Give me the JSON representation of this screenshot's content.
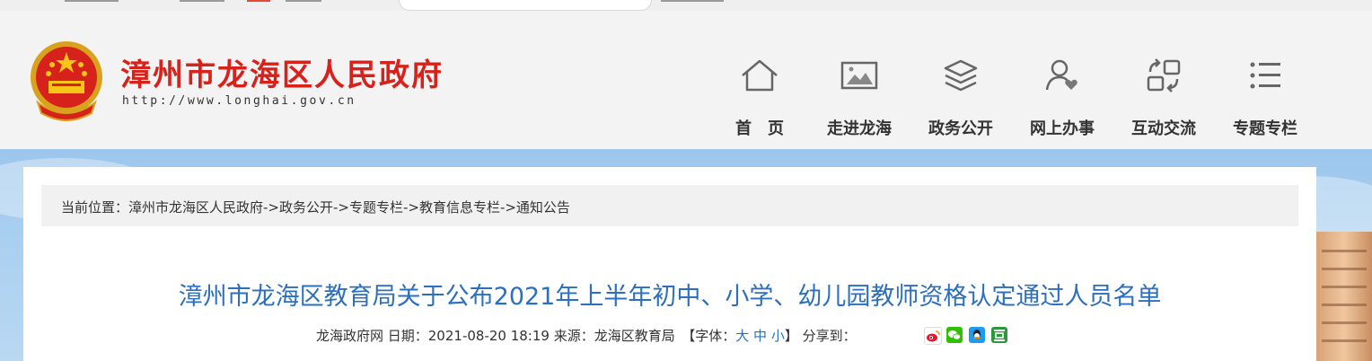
{
  "header": {
    "site_title": "漳州市龙海区人民政府",
    "site_url": "http://www.longhai.gov.cn"
  },
  "nav": [
    {
      "label": "首　页",
      "icon": "home-icon"
    },
    {
      "label": "走进龙海",
      "icon": "gallery-icon"
    },
    {
      "label": "政务公开",
      "icon": "layers-icon"
    },
    {
      "label": "网上办事",
      "icon": "user-heart-icon"
    },
    {
      "label": "互动交流",
      "icon": "exchange-icon"
    },
    {
      "label": "专题专栏",
      "icon": "list-icon"
    }
  ],
  "breadcrumb": "当前位置：漳州市龙海区人民政府->政务公开->专题专栏->教育信息专栏->通知公告",
  "article": {
    "title": "漳州市龙海区教育局关于公布2021年上半年初中、小学、幼儿园教师资格认定通过人员名单",
    "meta_prefix": "龙海政府网 日期：2021-08-20 18:19  来源：龙海区教育局　【字体：",
    "font_large": "大",
    "font_medium": "中",
    "font_small": "小",
    "meta_suffix": "】 分享到：",
    "share_icons": [
      "weibo-icon",
      "wechat-icon",
      "qq-icon",
      "douban-icon"
    ]
  },
  "colors": {
    "brand_red": "#d7221b",
    "title_blue": "#2b6fc0"
  }
}
